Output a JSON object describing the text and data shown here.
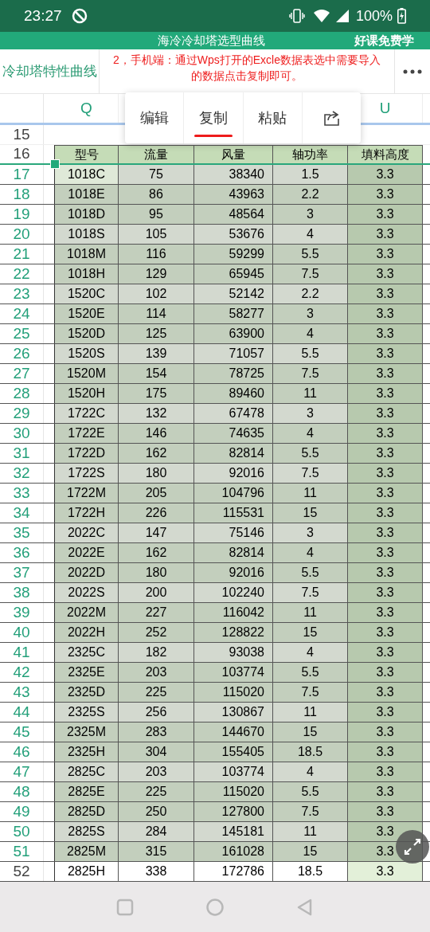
{
  "status_bar": {
    "time": "23:27",
    "battery": "100%"
  },
  "title_bar": {
    "title": "海冷冷却塔选型曲线",
    "brand": "好课免费学"
  },
  "sheet_name": "冷却塔特性曲线",
  "annotation": "2，手机端：通过Wps打开的Excle数据表选中需要导入的数据点击复制即可。",
  "context_menu": [
    {
      "kind": "text",
      "label": "编辑",
      "underlined": false
    },
    {
      "kind": "text",
      "label": "复制",
      "underlined": true
    },
    {
      "kind": "text",
      "label": "粘贴",
      "underlined": false
    },
    {
      "kind": "share"
    }
  ],
  "column_headers": [
    "Q",
    "U"
  ],
  "empty_row": "15",
  "header_row": {
    "number": "16",
    "cells": [
      "型号",
      "流量",
      "风量",
      "轴功率",
      "填料高度"
    ]
  },
  "rows": [
    {
      "number": "17",
      "selected": true,
      "cells": [
        "1018C",
        "75",
        "38340",
        "1.5",
        "3.3"
      ]
    },
    {
      "number": "18",
      "selected": true,
      "cells": [
        "1018E",
        "86",
        "43963",
        "2.2",
        "3.3"
      ]
    },
    {
      "number": "19",
      "selected": true,
      "cells": [
        "1018D",
        "95",
        "48564",
        "3",
        "3.3"
      ]
    },
    {
      "number": "20",
      "selected": true,
      "cells": [
        "1018S",
        "105",
        "53676",
        "4",
        "3.3"
      ]
    },
    {
      "number": "21",
      "selected": true,
      "cells": [
        "1018M",
        "116",
        "59299",
        "5.5",
        "3.3"
      ]
    },
    {
      "number": "22",
      "selected": true,
      "cells": [
        "1018H",
        "129",
        "65945",
        "7.5",
        "3.3"
      ]
    },
    {
      "number": "23",
      "selected": true,
      "cells": [
        "1520C",
        "102",
        "52142",
        "2.2",
        "3.3"
      ]
    },
    {
      "number": "24",
      "selected": true,
      "cells": [
        "1520E",
        "114",
        "58277",
        "3",
        "3.3"
      ]
    },
    {
      "number": "25",
      "selected": true,
      "cells": [
        "1520D",
        "125",
        "63900",
        "4",
        "3.3"
      ]
    },
    {
      "number": "26",
      "selected": true,
      "cells": [
        "1520S",
        "139",
        "71057",
        "5.5",
        "3.3"
      ]
    },
    {
      "number": "27",
      "selected": true,
      "cells": [
        "1520M",
        "154",
        "78725",
        "7.5",
        "3.3"
      ]
    },
    {
      "number": "28",
      "selected": true,
      "cells": [
        "1520H",
        "175",
        "89460",
        "11",
        "3.3"
      ]
    },
    {
      "number": "29",
      "selected": true,
      "cells": [
        "1722C",
        "132",
        "67478",
        "3",
        "3.3"
      ]
    },
    {
      "number": "30",
      "selected": true,
      "cells": [
        "1722E",
        "146",
        "74635",
        "4",
        "3.3"
      ]
    },
    {
      "number": "31",
      "selected": true,
      "cells": [
        "1722D",
        "162",
        "82814",
        "5.5",
        "3.3"
      ]
    },
    {
      "number": "32",
      "selected": true,
      "cells": [
        "1722S",
        "180",
        "92016",
        "7.5",
        "3.3"
      ]
    },
    {
      "number": "33",
      "selected": true,
      "cells": [
        "1722M",
        "205",
        "104796",
        "11",
        "3.3"
      ]
    },
    {
      "number": "34",
      "selected": true,
      "cells": [
        "1722H",
        "226",
        "115531",
        "15",
        "3.3"
      ]
    },
    {
      "number": "35",
      "selected": true,
      "cells": [
        "2022C",
        "147",
        "75146",
        "3",
        "3.3"
      ]
    },
    {
      "number": "36",
      "selected": true,
      "cells": [
        "2022E",
        "162",
        "82814",
        "4",
        "3.3"
      ]
    },
    {
      "number": "37",
      "selected": true,
      "cells": [
        "2022D",
        "180",
        "92016",
        "5.5",
        "3.3"
      ]
    },
    {
      "number": "38",
      "selected": true,
      "cells": [
        "2022S",
        "200",
        "102240",
        "7.5",
        "3.3"
      ]
    },
    {
      "number": "39",
      "selected": true,
      "cells": [
        "2022M",
        "227",
        "116042",
        "11",
        "3.3"
      ]
    },
    {
      "number": "40",
      "selected": true,
      "cells": [
        "2022H",
        "252",
        "128822",
        "15",
        "3.3"
      ]
    },
    {
      "number": "41",
      "selected": true,
      "cells": [
        "2325C",
        "182",
        "93038",
        "4",
        "3.3"
      ]
    },
    {
      "number": "42",
      "selected": true,
      "cells": [
        "2325E",
        "203",
        "103774",
        "5.5",
        "3.3"
      ]
    },
    {
      "number": "43",
      "selected": true,
      "cells": [
        "2325D",
        "225",
        "115020",
        "7.5",
        "3.3"
      ]
    },
    {
      "number": "44",
      "selected": true,
      "cells": [
        "2325S",
        "256",
        "130867",
        "11",
        "3.3"
      ]
    },
    {
      "number": "45",
      "selected": true,
      "cells": [
        "2325M",
        "283",
        "144670",
        "15",
        "3.3"
      ]
    },
    {
      "number": "46",
      "selected": true,
      "cells": [
        "2325H",
        "304",
        "155405",
        "18.5",
        "3.3"
      ]
    },
    {
      "number": "47",
      "selected": true,
      "cells": [
        "2825C",
        "203",
        "103774",
        "4",
        "3.3"
      ]
    },
    {
      "number": "48",
      "selected": true,
      "cells": [
        "2825E",
        "225",
        "115020",
        "5.5",
        "3.3"
      ]
    },
    {
      "number": "49",
      "selected": true,
      "cells": [
        "2825D",
        "250",
        "127800",
        "7.5",
        "3.3"
      ]
    },
    {
      "number": "50",
      "selected": true,
      "cells": [
        "2825S",
        "284",
        "145181",
        "11",
        "3.3"
      ]
    },
    {
      "number": "51",
      "selected": true,
      "cells": [
        "2825M",
        "315",
        "161028",
        "15",
        "3.3"
      ]
    },
    {
      "number": "52",
      "selected": false,
      "cells": [
        "2825H",
        "338",
        "172786",
        "18.5",
        "3.3"
      ]
    }
  ]
}
